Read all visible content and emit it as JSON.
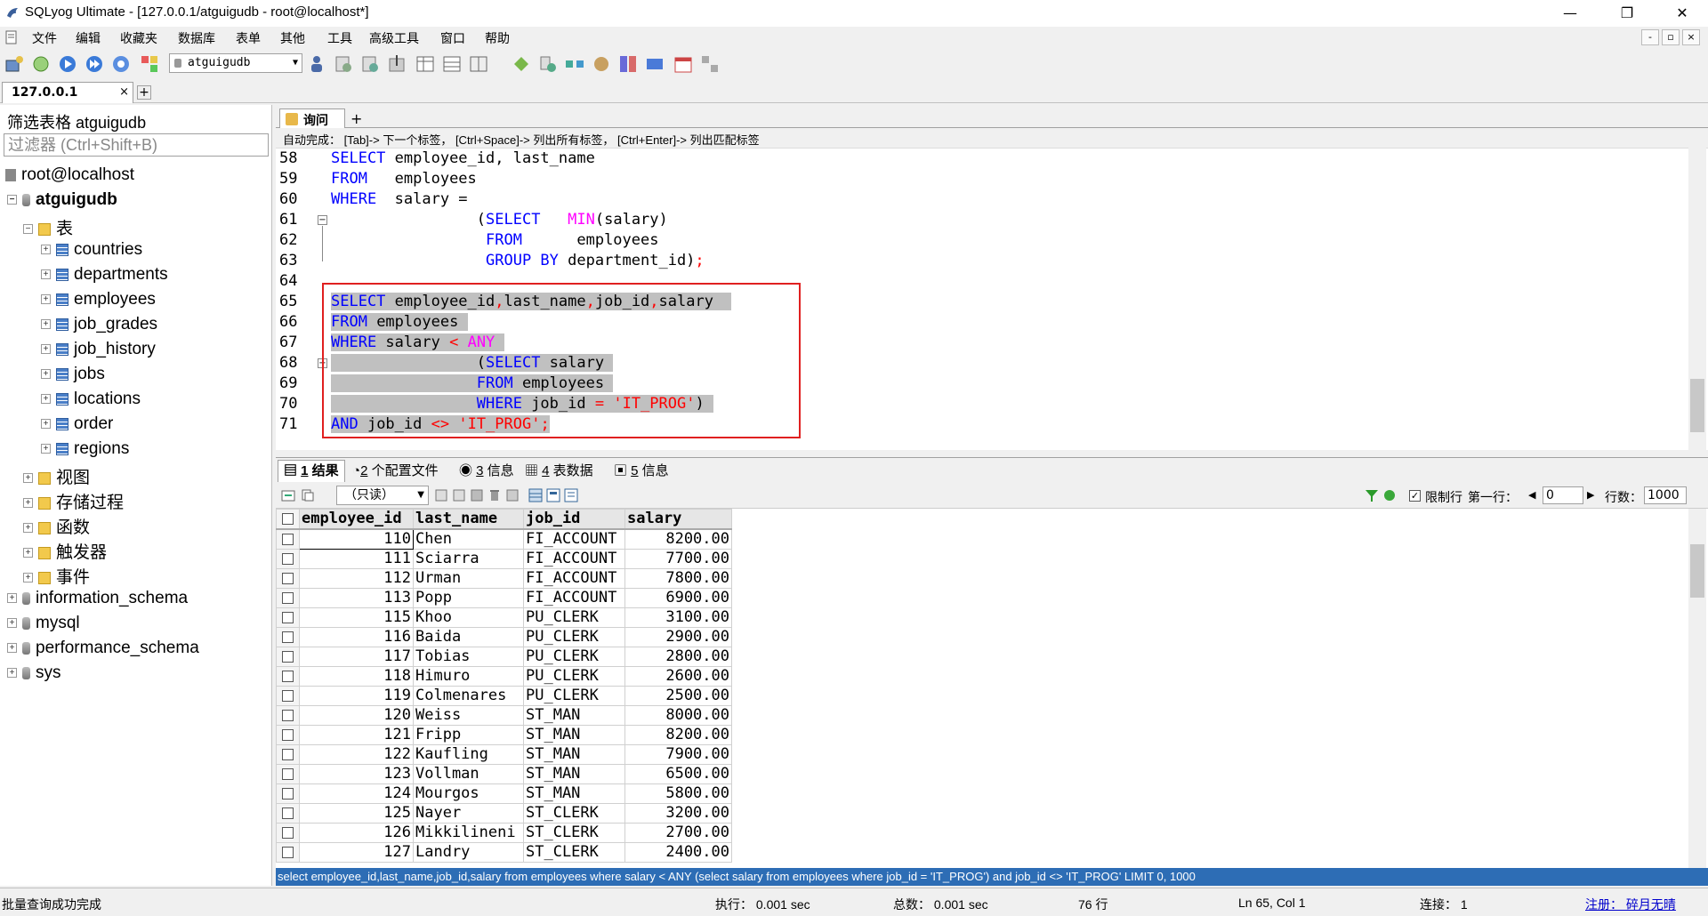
{
  "window": {
    "title": "SQLyog Ultimate - [127.0.0.1/atguigudb - root@localhost*]",
    "min": "—",
    "max": "❐",
    "close": "✕"
  },
  "menu": [
    "文件",
    "编辑",
    "收藏夹",
    "数据库",
    "表单",
    "其他",
    "工具",
    "高级工具",
    "窗口",
    "帮助"
  ],
  "mdi_buttons": [
    "-",
    "▫",
    "×"
  ],
  "toolbar": {
    "db_selector": "atguigudb"
  },
  "connection_tab": {
    "label": "127.0.0.1",
    "close": "×",
    "add": "+"
  },
  "left": {
    "filter_title": "筛选表格 atguigudb",
    "filter_placeholder": "过滤器 (Ctrl+Shift+B)",
    "tree": {
      "server": "root@localhost",
      "db": "atguigudb",
      "tables_folder": "表",
      "tables": [
        "countries",
        "departments",
        "employees",
        "job_grades",
        "job_history",
        "jobs",
        "locations",
        "order",
        "regions"
      ],
      "folders": [
        "视图",
        "存储过程",
        "函数",
        "触发器",
        "事件"
      ],
      "other_dbs": [
        "information_schema",
        "mysql",
        "performance_schema",
        "sys"
      ]
    }
  },
  "query_tab": {
    "label": "询问",
    "add": "+"
  },
  "autocomplete": "自动完成：  [Tab]-> 下一个标签，  [Ctrl+Space]-> 列出所有标签，  [Ctrl+Enter]-> 列出匹配标签",
  "editor": {
    "line_numbers": [
      "58",
      "59",
      "60",
      "61",
      "62",
      "63",
      "64",
      "65",
      "66",
      "67",
      "68",
      "69",
      "70",
      "71"
    ],
    "l58": {
      "kw": "SELECT",
      "rest": " employee_id, last_name"
    },
    "l59": {
      "kw": "FROM",
      "rest": "   employees"
    },
    "l60": {
      "kw": "WHERE",
      "rest": "  salary ="
    },
    "l61": {
      "pad": "                ",
      "paren": "(",
      "kw": "SELECT",
      "sp": "   ",
      "fn": "MIN",
      "rest": "(salary)"
    },
    "l62": {
      "pad": "                 ",
      "kw": "FROM",
      "rest": "      employees"
    },
    "l63": {
      "pad": "                 ",
      "kw": "GROUP BY",
      "rest": " department_id)",
      "semi": ";"
    },
    "l65": {
      "kw": "SELECT",
      "rest": " employee_id",
      "c1": ",",
      "a": "last_name",
      "c2": ",",
      "b": "job_id",
      "c3": ",",
      "c": "salary"
    },
    "l66": {
      "kw": "FROM",
      "rest": " employees "
    },
    "l67": {
      "kw": "WHERE",
      "rest": " salary ",
      "op": "<",
      "sp": " ",
      "any": "ANY",
      "tail": " "
    },
    "l68": {
      "pad": "                ",
      "paren": "(",
      "kw": "SELECT",
      "rest": " salary "
    },
    "l69": {
      "pad": "                ",
      "kw": "FROM",
      "rest": " employees "
    },
    "l70": {
      "pad": "                ",
      "kw": "WHERE",
      "rest": " job_id ",
      "op": "=",
      "sp": " ",
      "str": "'IT_PROG'",
      "tail": ") "
    },
    "l71": {
      "kw": "AND",
      "rest": " job_id ",
      "op": "<>",
      "sp": " ",
      "str": "'IT_PROG'",
      "semi": ";"
    }
  },
  "result_tabs": [
    {
      "num": "1",
      "label": " 结果"
    },
    {
      "num": "2",
      "label": " 个配置文件"
    },
    {
      "num": "3",
      "label": " 信息"
    },
    {
      "num": "4",
      "label": " 表数据"
    },
    {
      "num": "5",
      "label": " 信息"
    }
  ],
  "result_toolbar": {
    "readonly": "（只读）",
    "limit_label": "限制行",
    "first_row_label": "第一行：",
    "first_row_value": "0",
    "rows_label": "行数：",
    "rows_value": "1000"
  },
  "grid": {
    "columns": [
      "employee_id",
      "last_name",
      "job_id",
      "salary"
    ],
    "rows": [
      [
        "110",
        "Chen",
        "FI_ACCOUNT",
        "8200.00"
      ],
      [
        "111",
        "Sciarra",
        "FI_ACCOUNT",
        "7700.00"
      ],
      [
        "112",
        "Urman",
        "FI_ACCOUNT",
        "7800.00"
      ],
      [
        "113",
        "Popp",
        "FI_ACCOUNT",
        "6900.00"
      ],
      [
        "115",
        "Khoo",
        "PU_CLERK",
        "3100.00"
      ],
      [
        "116",
        "Baida",
        "PU_CLERK",
        "2900.00"
      ],
      [
        "117",
        "Tobias",
        "PU_CLERK",
        "2800.00"
      ],
      [
        "118",
        "Himuro",
        "PU_CLERK",
        "2600.00"
      ],
      [
        "119",
        "Colmenares",
        "PU_CLERK",
        "2500.00"
      ],
      [
        "120",
        "Weiss",
        "ST_MAN",
        "8000.00"
      ],
      [
        "121",
        "Fripp",
        "ST_MAN",
        "8200.00"
      ],
      [
        "122",
        "Kaufling",
        "ST_MAN",
        "7900.00"
      ],
      [
        "123",
        "Vollman",
        "ST_MAN",
        "6500.00"
      ],
      [
        "124",
        "Mourgos",
        "ST_MAN",
        "5800.00"
      ],
      [
        "125",
        "Nayer",
        "ST_CLERK",
        "3200.00"
      ],
      [
        "126",
        "Mikkilineni",
        "ST_CLERK",
        "2700.00"
      ],
      [
        "127",
        "Landry",
        "ST_CLERK",
        "2400.00"
      ]
    ]
  },
  "sql_bar": "select employee_id,last_name,job_id,salary from employees where salary < ANY (select salary from employees where job_id = 'IT_PROG') and job_id <> 'IT_PROG' LIMIT 0, 1000",
  "status": {
    "message": "批量查询成功完成",
    "exec": "执行：  0.001 sec",
    "total": "总数：  0.001 sec",
    "rows": "76 行",
    "pos": "Ln 65, Col 1",
    "conn": "连接：  1",
    "register": "注册：  碎月无晴"
  },
  "colors": {
    "keyword": "#0000ff",
    "function": "#ff00ff",
    "string": "#ff0000",
    "highlight_box": "#e02020",
    "sql_bar": "#2d6db5"
  }
}
